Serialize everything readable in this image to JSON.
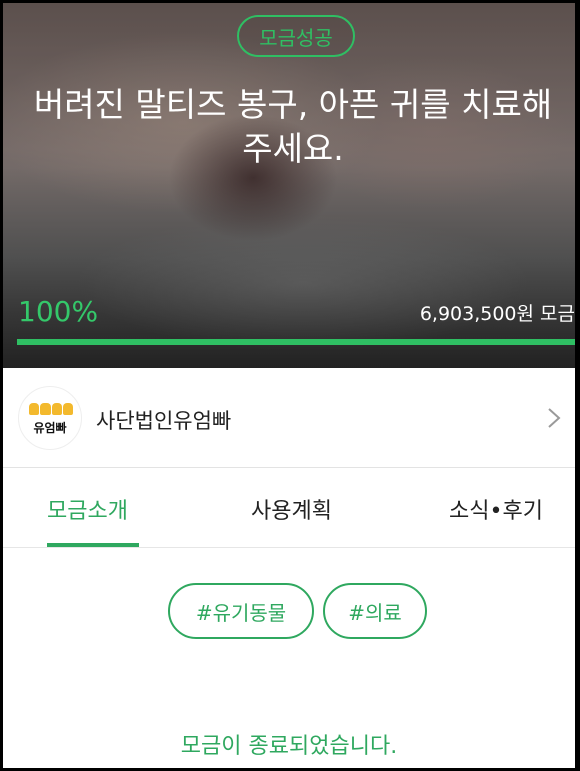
{
  "hero": {
    "badge": "모금성공",
    "title": "버려진 말티즈 봉구, 아픈 귀를 치료해 주세요.",
    "percent": "100%",
    "progress": 1.0,
    "amount": "6,903,500원 모금"
  },
  "org": {
    "logo_text": "유엄빠",
    "name": "사단법인유엄빠"
  },
  "tabs": [
    {
      "label": "모금소개",
      "active": true
    },
    {
      "label": "사용계획",
      "active": false
    },
    {
      "label": "소식•후기",
      "active": false
    }
  ],
  "tags": [
    "#유기동물",
    "#의료"
  ],
  "status_message": "모금이 종료되었습니다.",
  "colors": {
    "accent": "#2fa85f",
    "accent_bright": "#2fbf63",
    "logo_yellow": "#f3b92d"
  }
}
